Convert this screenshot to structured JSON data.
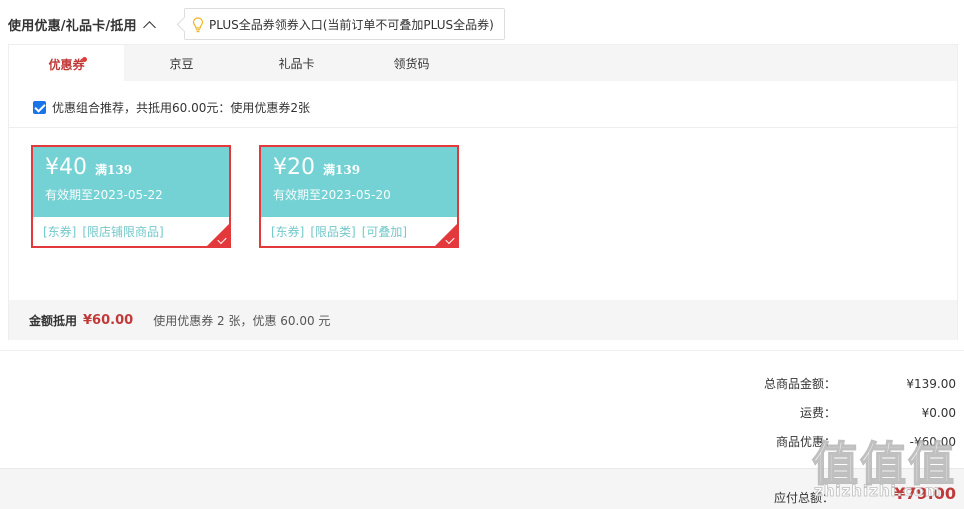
{
  "header": {
    "title": "使用优惠/礼品卡/抵用",
    "tip": "PLUS全品券领券入口(当前订单不可叠加PLUS全品券)"
  },
  "tabs": [
    {
      "label": "优惠券",
      "active": true
    },
    {
      "label": "京豆",
      "active": false
    },
    {
      "label": "礼品卡",
      "active": false
    },
    {
      "label": "领货码",
      "active": false
    }
  ],
  "recommend": {
    "checked": true,
    "text": "优惠组合推荐，共抵用60.00元：使用优惠券2张"
  },
  "coupons": [
    {
      "amount": "¥40",
      "condition": "满139",
      "validity": "有效期至2023-05-22",
      "tags": [
        "[东券]",
        "[限店铺限商品]"
      ],
      "selected": true
    },
    {
      "amount": "¥20",
      "condition": "满139",
      "validity": "有效期至2023-05-20",
      "tags": [
        "[东券]",
        "[限品类]",
        "[可叠加]"
      ],
      "selected": true
    }
  ],
  "summary": {
    "label": "金额抵用",
    "amount": "¥60.00",
    "desc": "使用优惠券 2 张，优惠 60.00 元"
  },
  "totals": [
    {
      "label": "总商品金额：",
      "value": "¥139.00"
    },
    {
      "label": "运费：",
      "value": "¥0.00"
    },
    {
      "label": "商品优惠：",
      "value": "-¥60.00"
    }
  ],
  "payable": {
    "label": "应付总额：",
    "value": "¥79.00"
  },
  "watermark": {
    "text": "值值值",
    "sub": "zhizhizhi.com"
  },
  "colors": {
    "accent": "#e4393c",
    "coupon_bg": "#74d2d4",
    "checkbox": "#1a73e8"
  }
}
